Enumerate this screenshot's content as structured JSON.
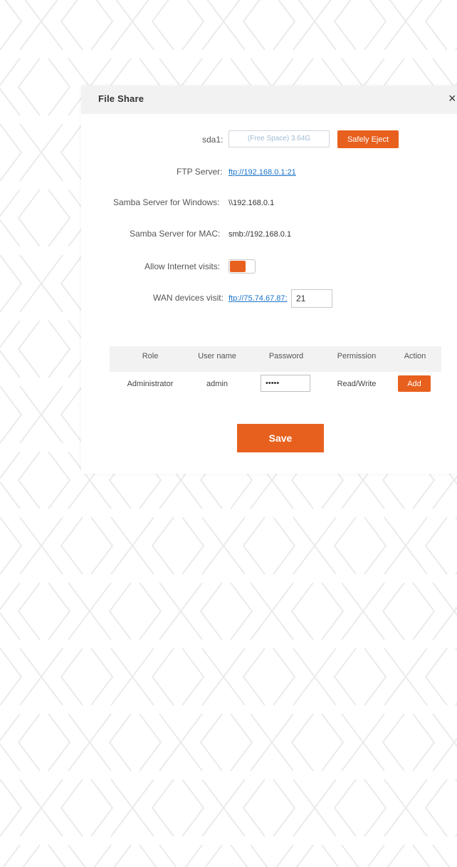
{
  "dialog": {
    "title": "File Share",
    "close_glyph": "×"
  },
  "storage": {
    "label": "sda1:",
    "free_space": "(Free Space) 3.64G",
    "eject_label": "Safely Eject"
  },
  "ftp": {
    "label": "FTP Server:",
    "url": "ftp://192.168.0.1:21"
  },
  "samba_windows": {
    "label": "Samba Server for Windows:",
    "value": "\\\\192.168.0.1"
  },
  "samba_mac": {
    "label": "Samba Server for MAC:",
    "value": "smb://192.168.0.1"
  },
  "internet": {
    "label": "Allow Internet visits:",
    "enabled": true
  },
  "wan": {
    "label": "WAN devices visit:",
    "url": "ftp://75.74.67.87:",
    "port": "21"
  },
  "table": {
    "headers": [
      "Role",
      "User name",
      "Password",
      "Permission",
      "Action"
    ],
    "row": {
      "role": "Administrator",
      "username": "admin",
      "password": "•••••",
      "permission": "Read/Write",
      "action_label": "Add"
    }
  },
  "save_label": "Save",
  "colors": {
    "accent": "#e8601e",
    "link": "#1a73c9",
    "header_bg": "#f2f2f2"
  }
}
